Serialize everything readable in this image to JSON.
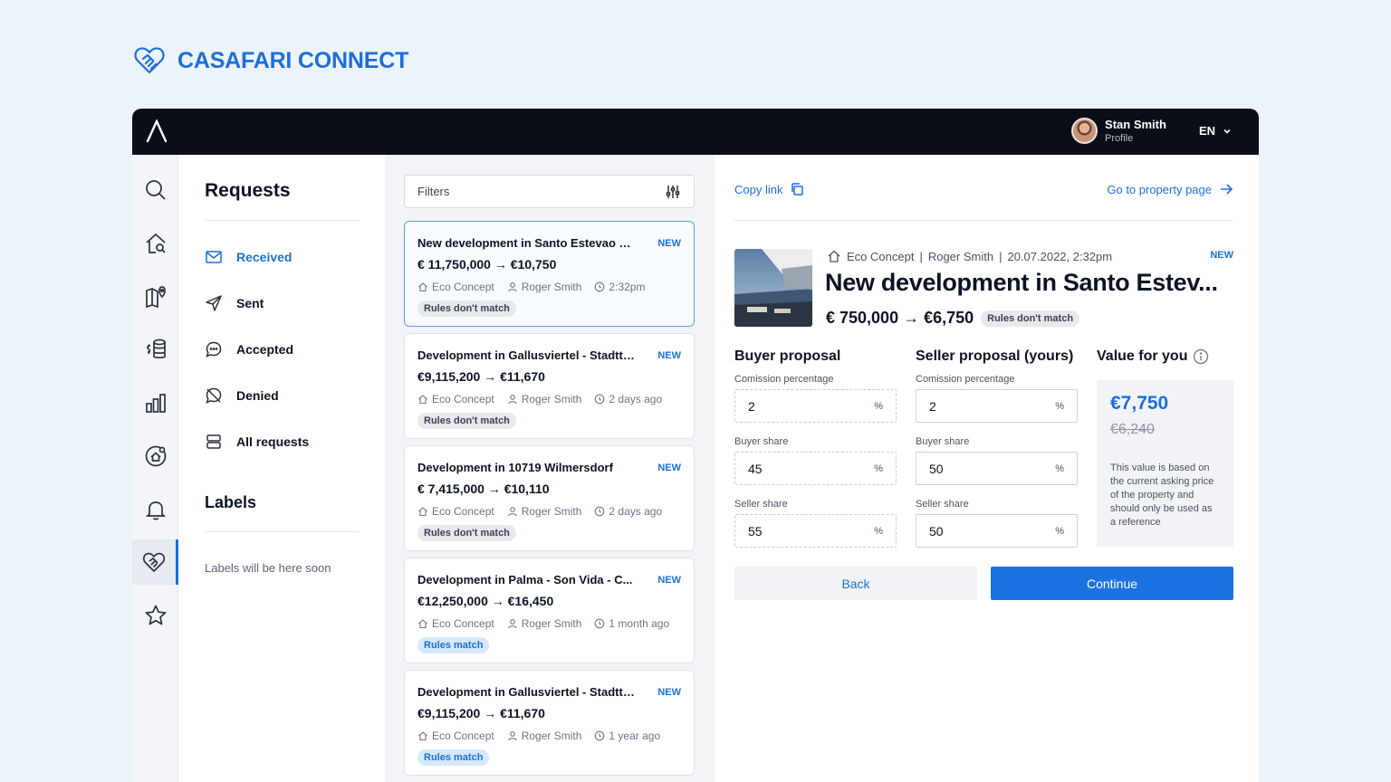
{
  "brand": {
    "name": "CASAFARI CONNECT"
  },
  "topbar": {
    "user_name": "Stan Smith",
    "user_subtitle": "Profile",
    "language": "EN"
  },
  "sidebar_icons": [
    "search-icon",
    "home-search-icon",
    "map-pin-icon",
    "money-stack-icon",
    "bar-chart-icon",
    "home-target-icon",
    "bell-icon",
    "handshake-icon",
    "star-icon"
  ],
  "requests_nav": {
    "title": "Requests",
    "items": [
      {
        "label": "Received",
        "icon": "envelope-icon"
      },
      {
        "label": "Sent",
        "icon": "send-icon"
      },
      {
        "label": "Accepted",
        "icon": "chat-bubble-icon"
      },
      {
        "label": "Denied",
        "icon": "denied-icon"
      },
      {
        "label": "All requests",
        "icon": "list-stack-icon"
      }
    ],
    "labels_title": "Labels",
    "labels_empty": "Labels will be here soon"
  },
  "list": {
    "filters_label": "Filters",
    "cards": [
      {
        "title": "New development in Santo Estevao E...",
        "badge": "NEW",
        "price": "€ 11,750,000 → €10,750",
        "agency": "Eco Concept",
        "agent": "Roger Smith",
        "time": "2:32pm",
        "tag": "Rules don't match",
        "tag_type": "nomatch"
      },
      {
        "title": "Development in Gallusviertel - Stadtteil",
        "badge": "NEW",
        "price": "€9,115,200 → €11,670",
        "agency": "Eco Concept",
        "agent": "Roger Smith",
        "time": "2 days ago",
        "tag": "Rules don't match",
        "tag_type": "nomatch"
      },
      {
        "title": "Development in 10719 Wilmersdorf",
        "badge": "NEW",
        "price": "€ 7,415,000 → €10,110",
        "agency": "Eco Concept",
        "agent": "Roger Smith",
        "time": "2 days ago",
        "tag": "Rules don't match",
        "tag_type": "nomatch"
      },
      {
        "title": "Development in Palma - Son Vida - C...",
        "badge": "NEW",
        "price": "€12,250,000 → €16,450",
        "agency": "Eco Concept",
        "agent": "Roger Smith",
        "time": "1 month ago",
        "tag": "Rules match",
        "tag_type": "match"
      },
      {
        "title": "Development in Gallusviertel - Stadtteil",
        "badge": "NEW",
        "price": "€9,115,200 → €11,670",
        "agency": "Eco Concept",
        "agent": "Roger Smith",
        "time": "1 year ago",
        "tag": "Rules match",
        "tag_type": "match"
      }
    ]
  },
  "detail": {
    "copy_link": "Copy link",
    "goto_property": "Go to property page",
    "agency": "Eco Concept",
    "agent": "Roger Smith",
    "datetime": "20.07.2022, 2:32pm",
    "meta_sep": "|",
    "badge": "NEW",
    "title": "New development in Santo Estev...",
    "price": "€ 750,000 → €6,750",
    "tag": "Rules don't match",
    "buyer": {
      "heading": "Buyer proposal",
      "commission_label": "Comission percentage",
      "commission": "2",
      "buyer_share_label": "Buyer share",
      "buyer_share": "45",
      "seller_share_label": "Seller share",
      "seller_share": "55"
    },
    "seller": {
      "heading": "Seller proposal (yours)",
      "commission_label": "Comission percentage",
      "commission": "2",
      "buyer_share_label": "Buyer share",
      "buyer_share": "50",
      "seller_share_label": "Seller share",
      "seller_share": "50"
    },
    "percent_sign": "%",
    "value": {
      "heading": "Value for you",
      "amount": "€7,750",
      "old_amount": "€6,240",
      "note": "This value is based on the current asking price of the property and should only be used as a reference"
    },
    "back_label": "Back",
    "continue_label": "Continue"
  },
  "colors": {
    "accent": "#1c6fd9",
    "topbar": "#0a0e17",
    "page_bg": "#edf3fb"
  }
}
